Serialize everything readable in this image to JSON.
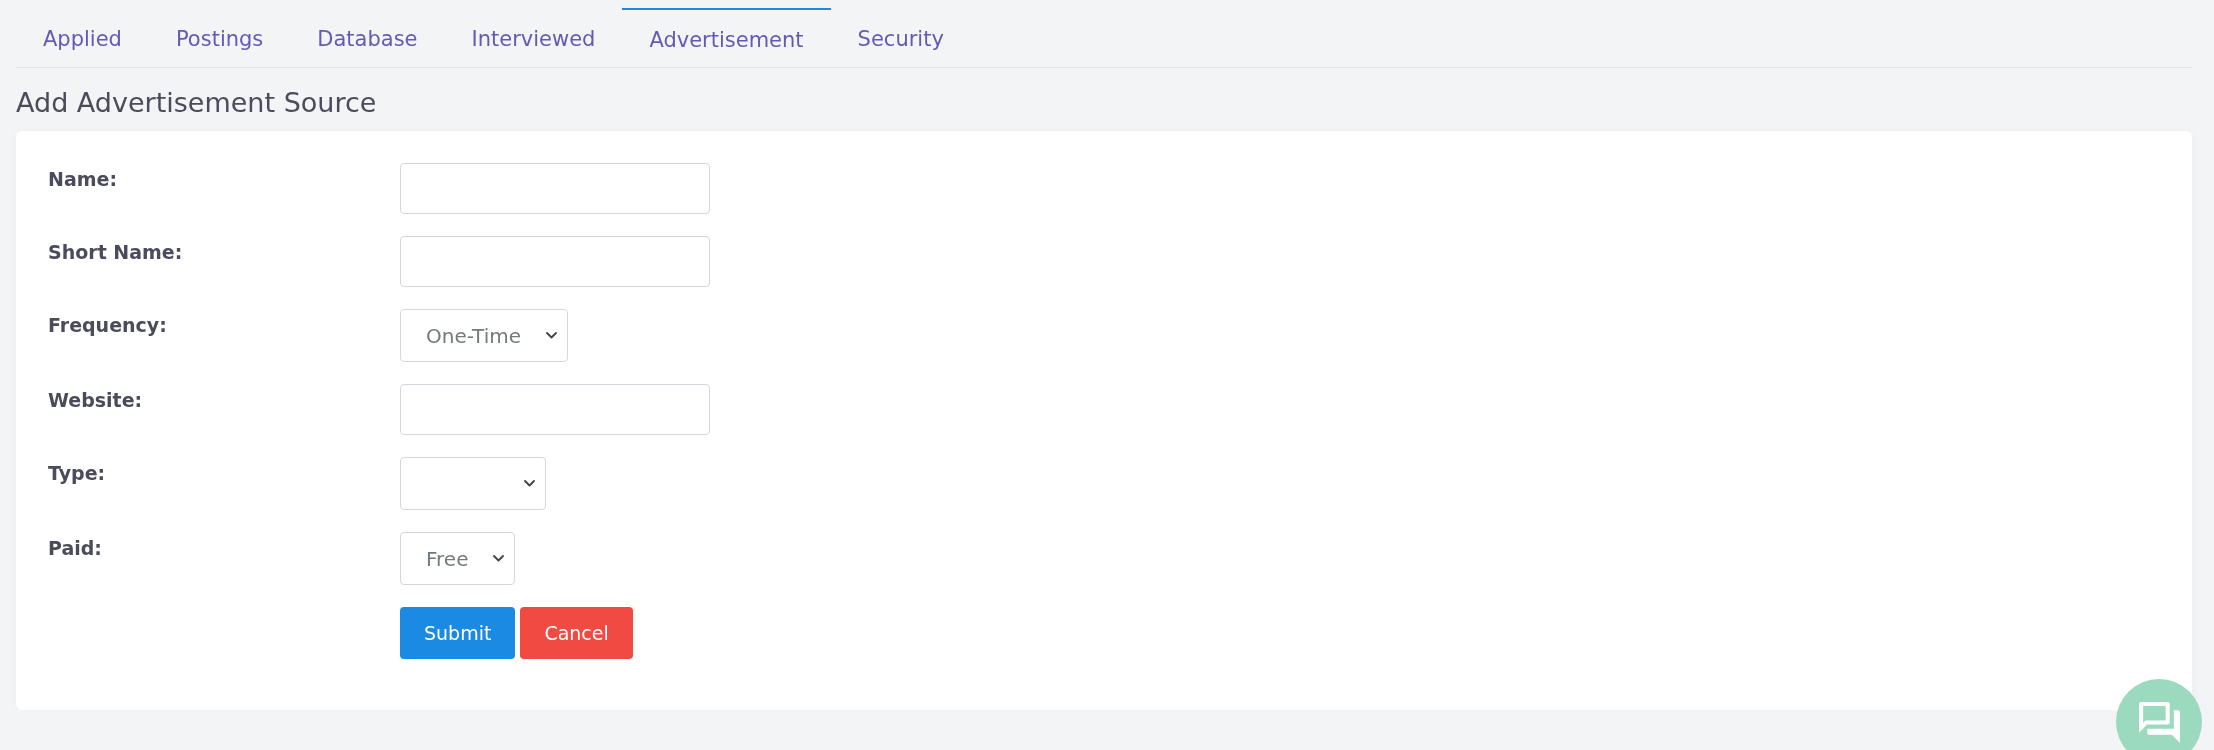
{
  "tabs": [
    {
      "label": "Applied",
      "selected": false
    },
    {
      "label": "Postings",
      "selected": false
    },
    {
      "label": "Database",
      "selected": false
    },
    {
      "label": "Interviewed",
      "selected": false
    },
    {
      "label": "Advertisement",
      "selected": true
    },
    {
      "label": "Security",
      "selected": false
    }
  ],
  "heading": "Add Advertisement Source",
  "form": {
    "fields": [
      {
        "label": "Name:",
        "kind": "text"
      },
      {
        "label": "Short Name:",
        "kind": "text"
      },
      {
        "label": "Frequency:",
        "kind": "select",
        "value": "One-Time"
      },
      {
        "label": "Website:",
        "kind": "text"
      },
      {
        "label": "Type:",
        "kind": "select"
      },
      {
        "label": "Paid:",
        "kind": "select",
        "value": "Free"
      }
    ],
    "buttons": [
      {
        "label": "Submit",
        "kind": "primary"
      },
      {
        "label": "Cancel",
        "kind": "danger"
      }
    ]
  }
}
